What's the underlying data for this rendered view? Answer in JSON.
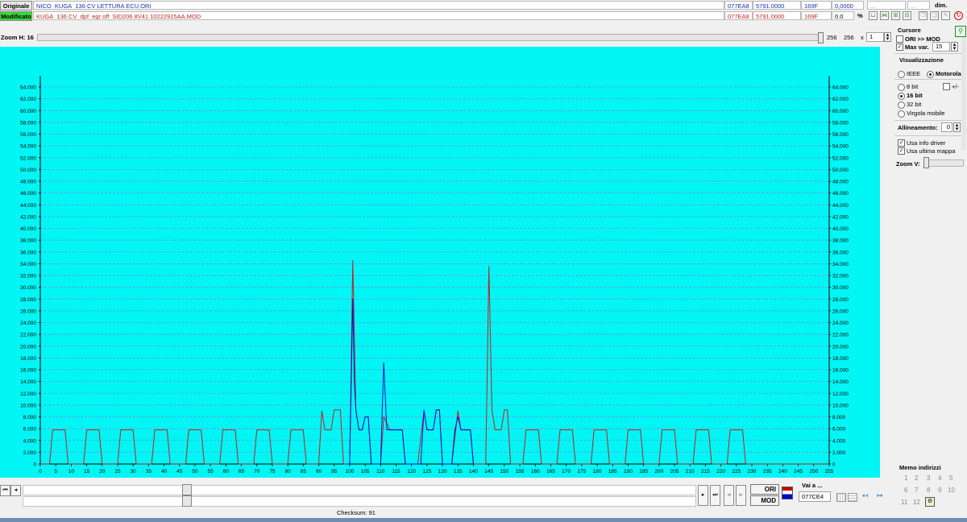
{
  "files": {
    "original": {
      "tag": "Originale",
      "name": "NICO_KUGA_136 CV LETTURA ECU.ORI",
      "addr": "077EA8",
      "val": "5791.0000",
      "hex": "169F",
      "diff": "0,0000",
      "dots": "...",
      "dots2": "..."
    },
    "modified": {
      "tag": "Modificato",
      "name": "KUGA_136 CV_dpf_egr off_SID206 8V41 10222915AA.MOD",
      "addr": "077EA8",
      "val": "5791.0000",
      "hex": "169F",
      "diff": "0.0",
      "pct": "%"
    },
    "dim_label": "dim."
  },
  "zoom_h": {
    "label": "Zoom H: 16",
    "v1": "256",
    "v2": "256",
    "x": "x",
    "v3": "1"
  },
  "cursore": {
    "title": "Cursore",
    "ori_mod": "ORI >> MOD",
    "max_var": "Max var.",
    "max_var_value": "15",
    "visualizzazione": "Visualizzazione",
    "ieee": "IEEE",
    "motorola": "Motorola",
    "bit8": "8 bit",
    "plusminus": "+/-",
    "bit16": "16 bit",
    "bit32": "32 bit",
    "virgola": "Virgola mobile",
    "allineamento": "Allineamento:",
    "allineamento_value": "0",
    "usa_info": "Usa info driver",
    "usa_ultima": "Usa ultima mappa",
    "zoom_v": "Zoom V:"
  },
  "memo": {
    "title": "Memo indirizzi",
    "nums": [
      "1",
      "2",
      "3",
      "4",
      "5",
      "6",
      "7",
      "8",
      "9",
      "10",
      "11",
      "12"
    ]
  },
  "bottom": {
    "ori": "ORI",
    "mod": "MOD",
    "vai": "Vai a ...",
    "vai_value": "077CE4",
    "checksum": "Checksum: 91"
  },
  "colors": {
    "plot_bg": "#00f5f5",
    "ori": "#c02020",
    "mod": "#1010c8",
    "grid": "#7d8ccc"
  },
  "chart_data": {
    "type": "line",
    "xlim": [
      0,
      255
    ],
    "ylim": [
      0,
      64000
    ],
    "x_ticks": [
      0,
      5,
      10,
      15,
      20,
      25,
      30,
      35,
      40,
      45,
      50,
      55,
      60,
      65,
      70,
      75,
      80,
      85,
      90,
      95,
      100,
      105,
      110,
      115,
      120,
      125,
      130,
      135,
      140,
      145,
      150,
      155,
      160,
      165,
      170,
      175,
      180,
      185,
      190,
      195,
      200,
      205,
      210,
      215,
      220,
      225,
      230,
      235,
      240,
      245,
      250,
      255
    ],
    "y_ticks": [
      0,
      2000,
      4000,
      6000,
      8000,
      10000,
      12000,
      14000,
      16000,
      18000,
      20000,
      22000,
      24000,
      26000,
      28000,
      30000,
      32000,
      34000,
      36000,
      38000,
      40000,
      42000,
      44000,
      46000,
      48000,
      50000,
      52000,
      54000,
      56000,
      58000,
      60000,
      62000,
      64000
    ],
    "y_tick_labels": [
      "0",
      "2.000",
      "4.000",
      "6.000",
      "8.000",
      "10.000",
      "12.000",
      "14.000",
      "16.000",
      "18.000",
      "20.000",
      "22.000",
      "24.000",
      "26.000",
      "28.000",
      "30.000",
      "32.000",
      "34.000",
      "36.000",
      "38.000",
      "40.000",
      "42.000",
      "44.000",
      "46.000",
      "48.000",
      "50.000",
      "52.000",
      "54.000",
      "56.000",
      "58.000",
      "60.000",
      "62.000",
      "64.000"
    ],
    "grid": true,
    "series": [
      {
        "color": "#c02020",
        "points": [
          [
            0,
            0
          ],
          [
            3,
            0
          ],
          [
            4,
            5800
          ],
          [
            8,
            5800
          ],
          [
            9,
            0
          ],
          [
            14,
            0
          ],
          [
            15,
            5800
          ],
          [
            19,
            5800
          ],
          [
            20,
            0
          ],
          [
            25,
            0
          ],
          [
            26,
            5800
          ],
          [
            30,
            5800
          ],
          [
            31,
            0
          ],
          [
            36,
            0
          ],
          [
            37,
            5800
          ],
          [
            41,
            5800
          ],
          [
            42,
            0
          ],
          [
            47,
            0
          ],
          [
            48,
            5800
          ],
          [
            52,
            5800
          ],
          [
            53,
            0
          ],
          [
            58,
            0
          ],
          [
            59,
            5800
          ],
          [
            63,
            5800
          ],
          [
            64,
            0
          ],
          [
            69,
            0
          ],
          [
            70,
            5800
          ],
          [
            74,
            5800
          ],
          [
            75,
            0
          ],
          [
            80,
            0
          ],
          [
            81,
            5800
          ],
          [
            85,
            5800
          ],
          [
            86,
            0
          ],
          [
            90,
            0
          ],
          [
            91,
            9000
          ],
          [
            92,
            5800
          ],
          [
            94,
            5800
          ],
          [
            95,
            9200
          ],
          [
            97,
            9200
          ],
          [
            98,
            0
          ],
          [
            100,
            0
          ],
          [
            101,
            34500
          ],
          [
            102,
            9200
          ],
          [
            103,
            5800
          ],
          [
            104,
            5800
          ],
          [
            105,
            8000
          ],
          [
            106,
            8000
          ],
          [
            107,
            0
          ],
          [
            110,
            0
          ],
          [
            111,
            8000
          ],
          [
            113,
            5800
          ],
          [
            117,
            5800
          ],
          [
            118,
            0
          ],
          [
            122,
            0
          ],
          [
            124,
            9000
          ],
          [
            125,
            5800
          ],
          [
            127,
            5800
          ],
          [
            128,
            9200
          ],
          [
            129,
            9200
          ],
          [
            130,
            0
          ],
          [
            133,
            0
          ],
          [
            135,
            9000
          ],
          [
            136,
            5800
          ],
          [
            139,
            5800
          ],
          [
            140,
            0
          ],
          [
            144,
            0
          ],
          [
            145,
            33500
          ],
          [
            146,
            9200
          ],
          [
            147,
            5800
          ],
          [
            149,
            5800
          ],
          [
            150,
            9200
          ],
          [
            151,
            9200
          ],
          [
            152,
            0
          ],
          [
            156,
            0
          ],
          [
            157,
            5800
          ],
          [
            161,
            5800
          ],
          [
            162,
            0
          ],
          [
            167,
            0
          ],
          [
            168,
            5800
          ],
          [
            172,
            5800
          ],
          [
            173,
            0
          ],
          [
            178,
            0
          ],
          [
            179,
            5800
          ],
          [
            183,
            5800
          ],
          [
            184,
            0
          ],
          [
            189,
            0
          ],
          [
            190,
            5800
          ],
          [
            194,
            5800
          ],
          [
            195,
            0
          ],
          [
            200,
            0
          ],
          [
            201,
            5800
          ],
          [
            205,
            5800
          ],
          [
            206,
            0
          ],
          [
            211,
            0
          ],
          [
            212,
            5800
          ],
          [
            216,
            5800
          ],
          [
            217,
            0
          ],
          [
            222,
            0
          ],
          [
            223,
            5800
          ],
          [
            227,
            5800
          ],
          [
            228,
            0
          ],
          [
            255,
            0
          ]
        ]
      },
      {
        "color": "#1010c8",
        "points": [
          [
            99,
            0
          ],
          [
            100,
            0
          ],
          [
            101,
            28000
          ],
          [
            101.5,
            14000
          ],
          [
            102,
            9200
          ],
          [
            103,
            5800
          ],
          [
            104,
            5800
          ],
          [
            105,
            8000
          ],
          [
            106,
            8000
          ],
          [
            107,
            0
          ],
          [
            110,
            0
          ],
          [
            111,
            17200
          ],
          [
            112,
            5800
          ],
          [
            113,
            5800
          ],
          [
            114,
            5800
          ],
          [
            115,
            5800
          ],
          [
            116,
            5800
          ],
          [
            117,
            5800
          ],
          [
            118,
            0
          ],
          [
            122,
            0
          ],
          [
            123,
            0
          ],
          [
            124,
            9200
          ],
          [
            125,
            5800
          ],
          [
            127,
            5800
          ],
          [
            128,
            9200
          ],
          [
            129,
            9200
          ],
          [
            130,
            0
          ],
          [
            133,
            0
          ],
          [
            134,
            5800
          ],
          [
            135,
            8000
          ],
          [
            136,
            5800
          ],
          [
            137,
            5800
          ],
          [
            138,
            5800
          ],
          [
            139,
            5800
          ],
          [
            140,
            0
          ]
        ]
      }
    ]
  }
}
